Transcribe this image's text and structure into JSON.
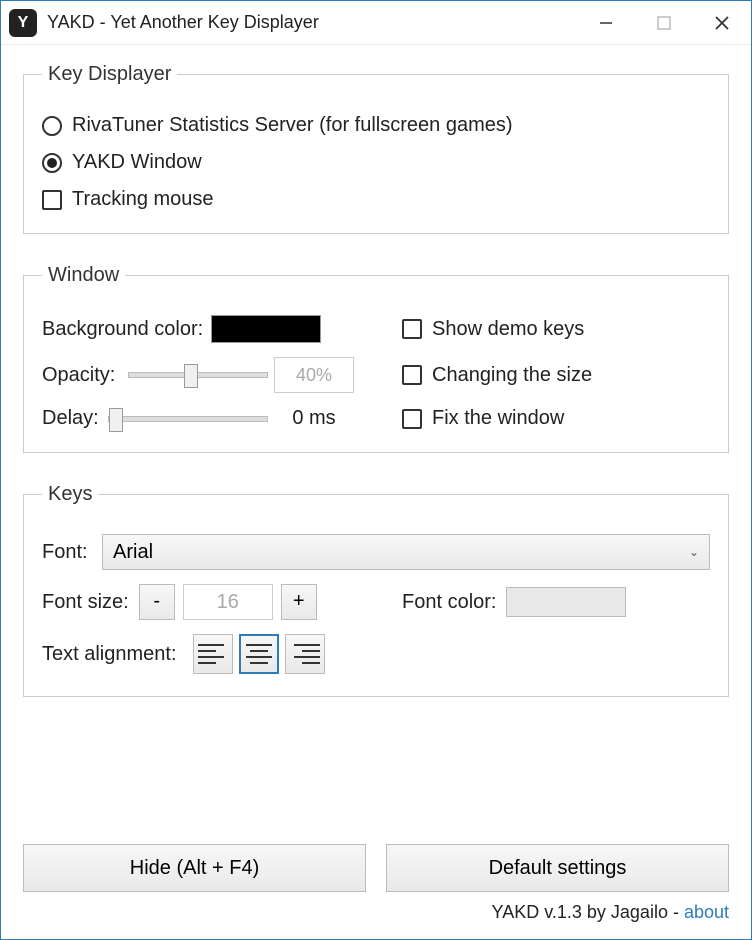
{
  "app": {
    "icon_letter": "Y",
    "title": "YAKD - Yet Another Key Displayer"
  },
  "groups": {
    "key_displayer": {
      "legend": "Key Displayer",
      "radio_riva": "RivaTuner Statistics Server (for fullscreen games)",
      "radio_yakd": "YAKD Window",
      "check_mouse": "Tracking mouse"
    },
    "window": {
      "legend": "Window",
      "bgcolor_label": "Background color:",
      "opacity_label": "Opacity:",
      "opacity_value": "40%",
      "delay_label": "Delay:",
      "delay_value": "0 ms",
      "show_demo": "Show demo keys",
      "changing_size": "Changing the size",
      "fix_window": "Fix the window"
    },
    "keys": {
      "legend": "Keys",
      "font_label": "Font:",
      "font_value": "Arial",
      "fontsize_label": "Font size:",
      "fontsize_value": "16",
      "fontcolor_label": "Font color:",
      "align_label": "Text alignment:",
      "minus": "-",
      "plus": "+"
    }
  },
  "buttons": {
    "hide": "Hide (Alt + F4)",
    "defaults": "Default settings"
  },
  "footer": {
    "text": "YAKD v.1.3 by Jagailo - ",
    "link": "about"
  }
}
